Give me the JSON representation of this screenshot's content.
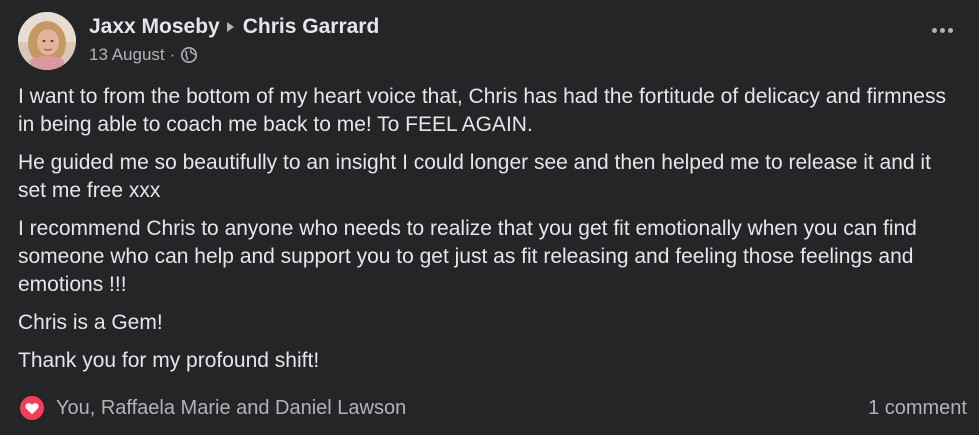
{
  "post": {
    "author": "Jaxx Moseby",
    "recipient": "Chris Garrard",
    "date": "13 August",
    "separator": "·",
    "audience_icon": "globe-icon",
    "more_icon": "more-options-icon",
    "paragraphs": [
      "I want to from the bottom of my heart voice that, Chris has had the fortitude of delicacy and firmness in being able to coach me back to me! To FEEL AGAIN.",
      "He guided me so beautifully to an insight I could longer see and then helped me to release it and it set me free xxx",
      "I recommend Chris to anyone who needs to realize that you get fit emotionally when you can find someone who can help and support you to get just as fit releasing and feeling those feelings and emotions !!!",
      "Chris is a Gem!",
      "Thank you for my profound shift!"
    ],
    "reactions_text": "You, Raffaela Marie and Daniel Lawson",
    "reaction_icon": "love-reaction-icon",
    "comments_text": "1 comment"
  },
  "colors": {
    "background": "#242526",
    "primary_text": "#e4e6eb",
    "secondary_text": "#b0b3b8",
    "love_reaction": "#f33e58"
  }
}
